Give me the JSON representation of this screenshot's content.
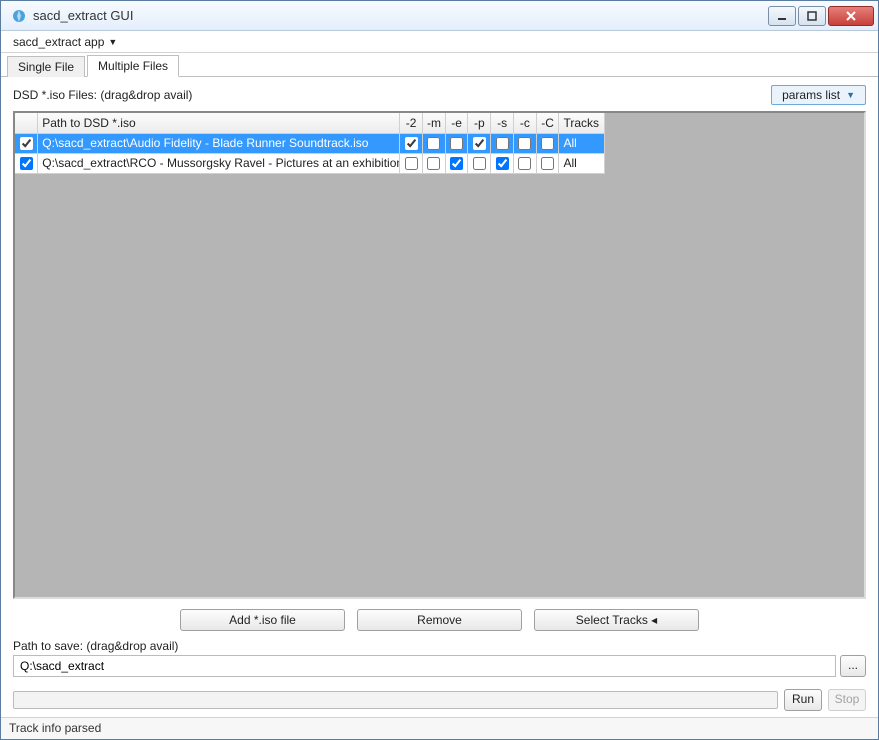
{
  "window": {
    "title": "sacd_extract GUI"
  },
  "menu": {
    "app_label": "sacd_extract app"
  },
  "tabs": {
    "single": "Single File",
    "multiple": "Multiple Files"
  },
  "content": {
    "dsd_hint": "DSD *.iso Files: (drag&drop avail)",
    "params_button": "params list"
  },
  "grid": {
    "headers": {
      "path": "Path to DSD *.iso",
      "f2": "-2",
      "fm": "-m",
      "fe": "-e",
      "fp": "-p",
      "fs": "-s",
      "fc": "-c",
      "fC": "-C",
      "tracks": "Tracks"
    },
    "rows": [
      {
        "selected": true,
        "enabled": true,
        "path": "Q:\\sacd_extract\\Audio Fidelity - Blade Runner Soundtrack.iso",
        "f2": true,
        "fm": false,
        "fe": false,
        "fp": true,
        "fs": false,
        "fc": false,
        "fC": false,
        "tracks": "All"
      },
      {
        "selected": false,
        "enabled": true,
        "path": "Q:\\sacd_extract\\RCO - Mussorgsky Ravel - Pictures at an exhibition.iso",
        "f2": false,
        "fm": false,
        "fe": true,
        "fp": false,
        "fs": true,
        "fc": false,
        "fC": false,
        "tracks": "All"
      }
    ]
  },
  "buttons": {
    "add": "Add *.iso file",
    "remove": "Remove",
    "select_tracks": "Select Tracks ◂"
  },
  "save": {
    "label": "Path to save: (drag&drop avail)",
    "value": "Q:\\sacd_extract",
    "browse": "..."
  },
  "run": {
    "run": "Run",
    "stop": "Stop"
  },
  "status": "Track info parsed"
}
